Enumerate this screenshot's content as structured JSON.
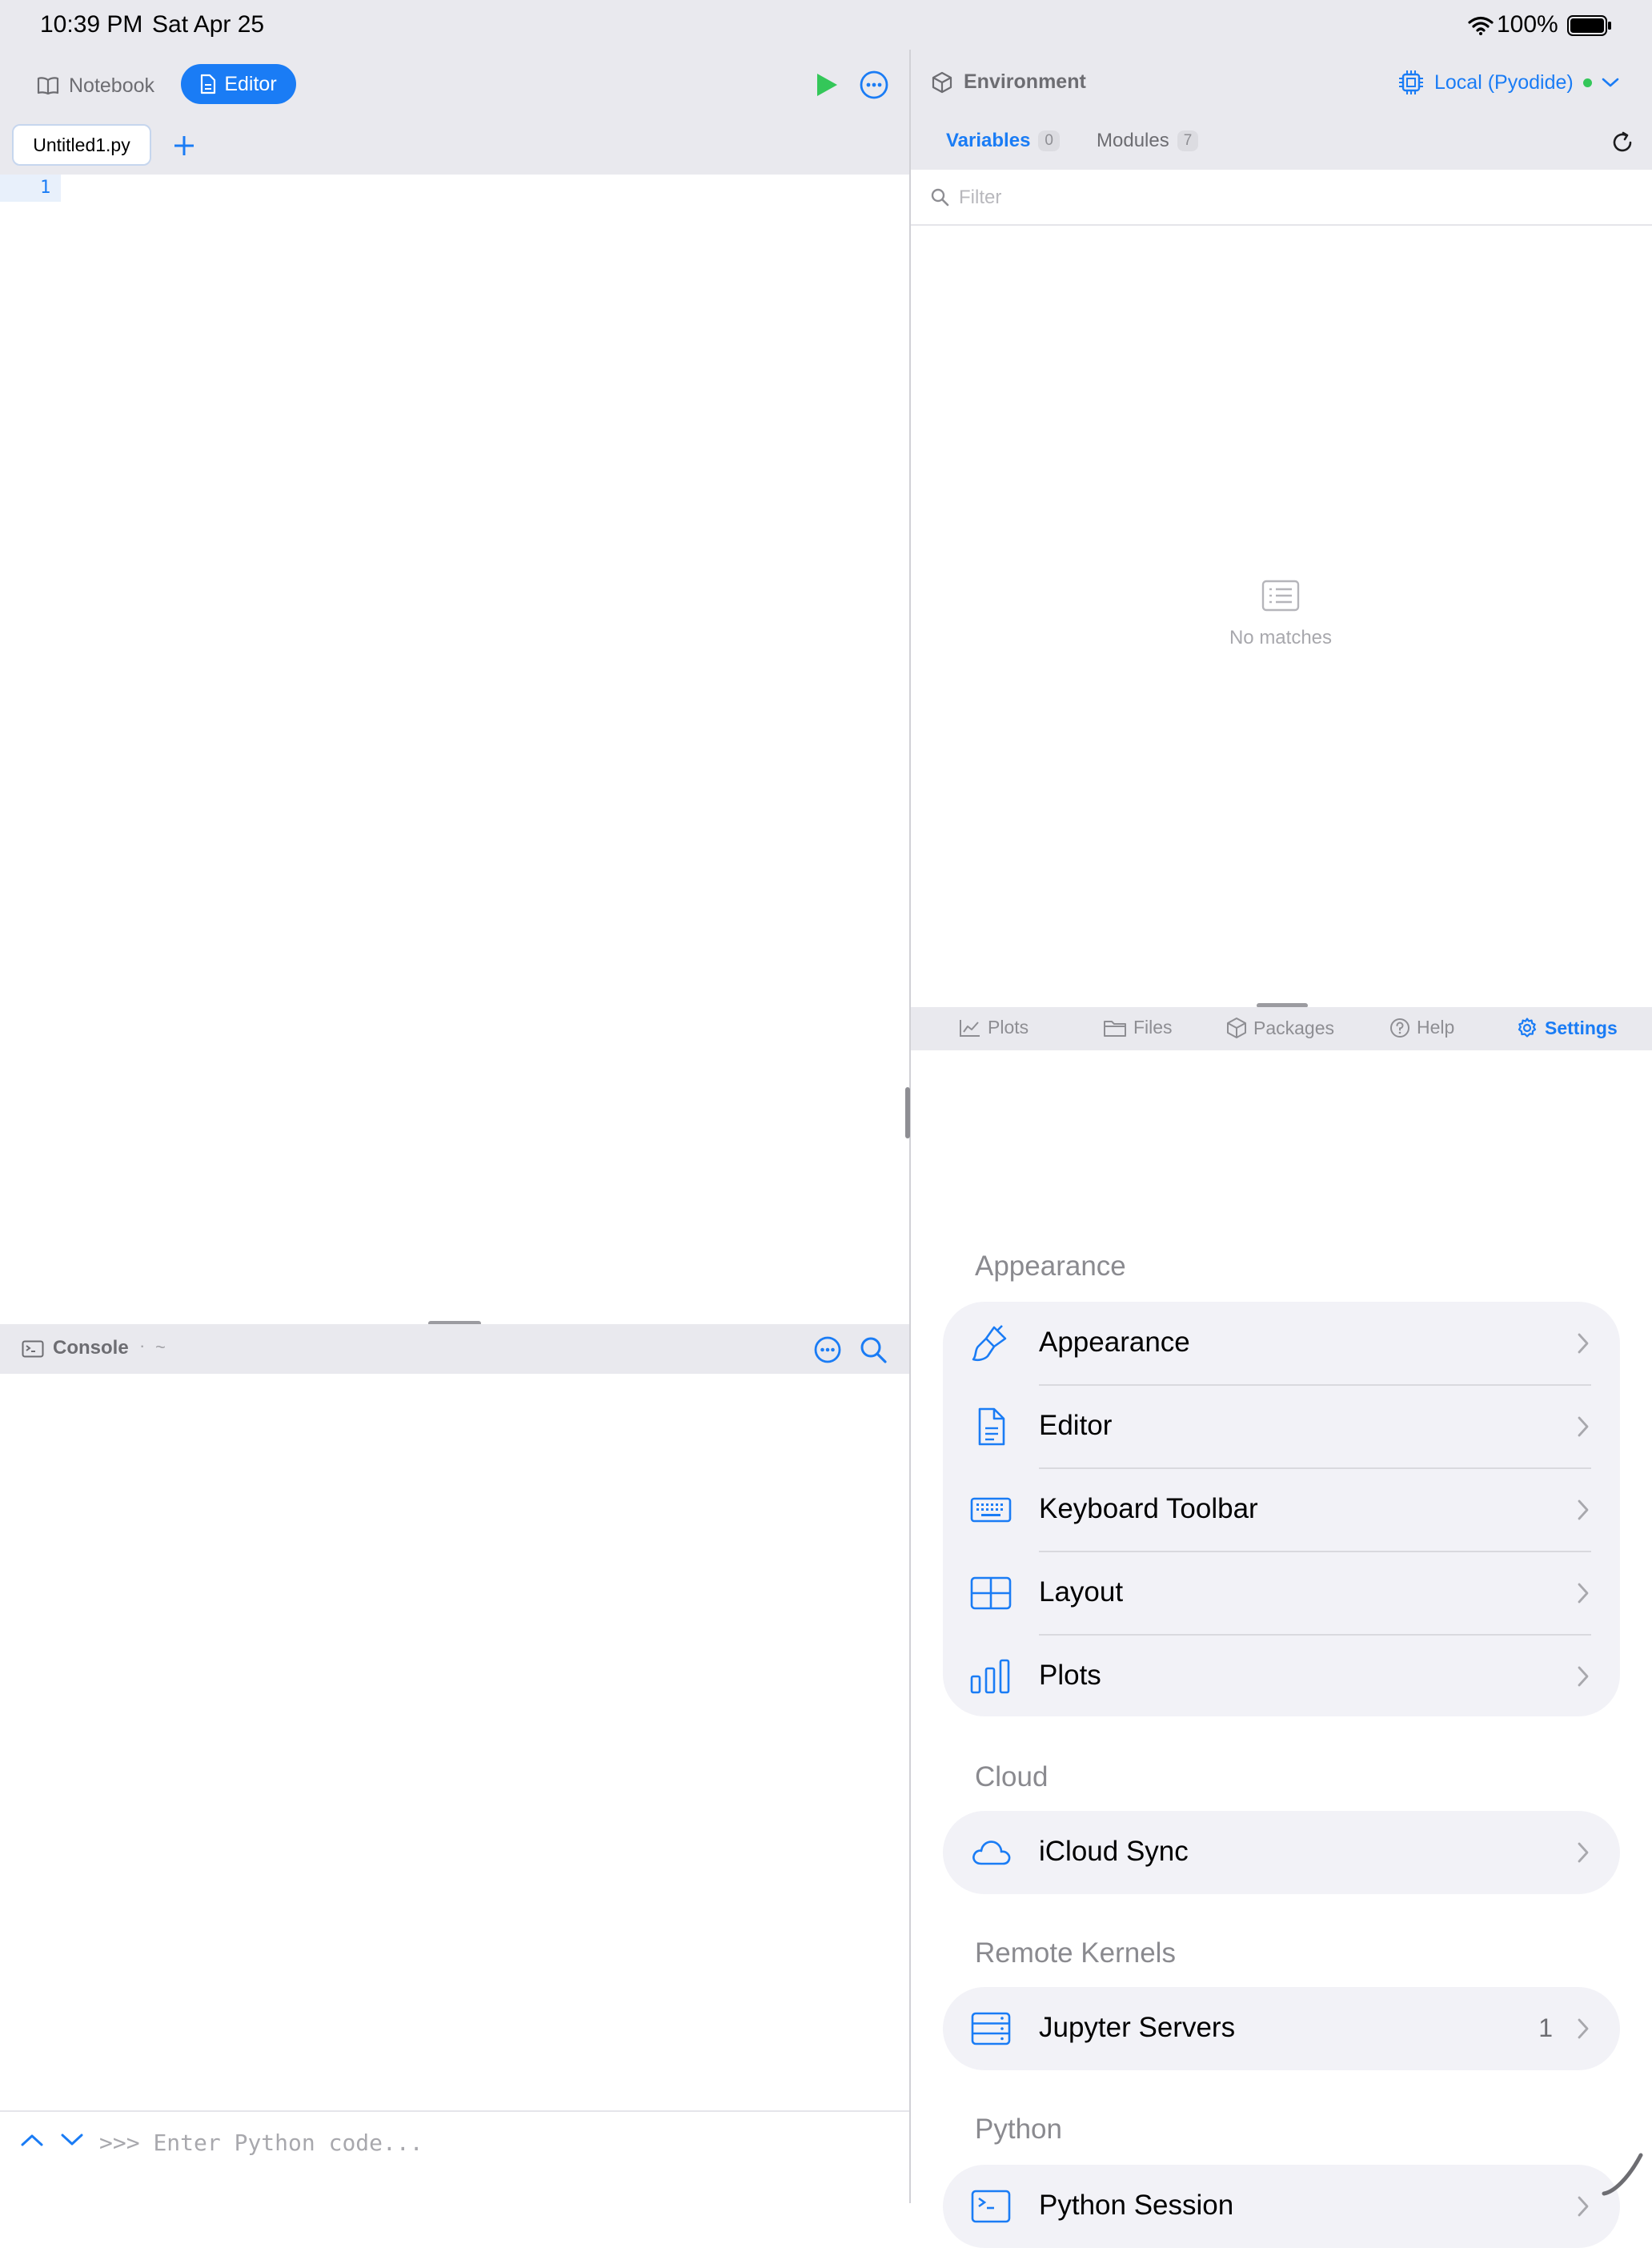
{
  "status_bar": {
    "time": "10:39 PM",
    "date": "Sat Apr 25",
    "battery": "100%"
  },
  "left_pane": {
    "modes": [
      {
        "label": "Notebook"
      },
      {
        "label": "Editor"
      }
    ],
    "active_mode": "Editor",
    "file_tabs": [
      {
        "label": "Untitled1.py"
      }
    ],
    "editor": {
      "line_numbers": [
        "1"
      ],
      "content": ""
    },
    "console": {
      "title": "Console",
      "path": "~",
      "prompt": ">>>",
      "input_placeholder": "Enter Python code..."
    }
  },
  "right_pane": {
    "environment_title": "Environment",
    "kernel": {
      "label": "Local (Pyodide)",
      "status_color": "#34c759"
    },
    "tabs": [
      {
        "label": "Variables",
        "count": "0"
      },
      {
        "label": "Modules",
        "count": "7"
      }
    ],
    "filter_placeholder": "Filter",
    "empty_message": "No matches",
    "bottom_tabs": [
      {
        "label": "Plots",
        "icon": "chart-icon"
      },
      {
        "label": "Files",
        "icon": "folder-icon"
      },
      {
        "label": "Packages",
        "icon": "box-icon"
      },
      {
        "label": "Help",
        "icon": "question-icon"
      },
      {
        "label": "Settings",
        "icon": "gear-icon"
      }
    ],
    "active_bottom_tab": "Settings",
    "settings": {
      "sections": [
        {
          "header": "Appearance",
          "items": [
            {
              "label": "Appearance",
              "icon": "paintbrush-icon"
            },
            {
              "label": "Editor",
              "icon": "document-icon"
            },
            {
              "label": "Keyboard Toolbar",
              "icon": "keyboard-icon"
            },
            {
              "label": "Layout",
              "icon": "grid-icon"
            },
            {
              "label": "Plots",
              "icon": "bar-chart-icon"
            }
          ]
        },
        {
          "header": "Cloud",
          "items": [
            {
              "label": "iCloud Sync",
              "icon": "cloud-icon"
            }
          ]
        },
        {
          "header": "Remote Kernels",
          "items": [
            {
              "label": "Jupyter Servers",
              "icon": "server-icon",
              "badge": "1"
            }
          ]
        },
        {
          "header": "Python",
          "items": [
            {
              "label": "Python Session",
              "icon": "terminal-icon"
            }
          ]
        }
      ]
    }
  },
  "colors": {
    "accent": "#1a7cf5",
    "run_button": "#34c759",
    "chrome_bg": "#e9e9ee"
  }
}
